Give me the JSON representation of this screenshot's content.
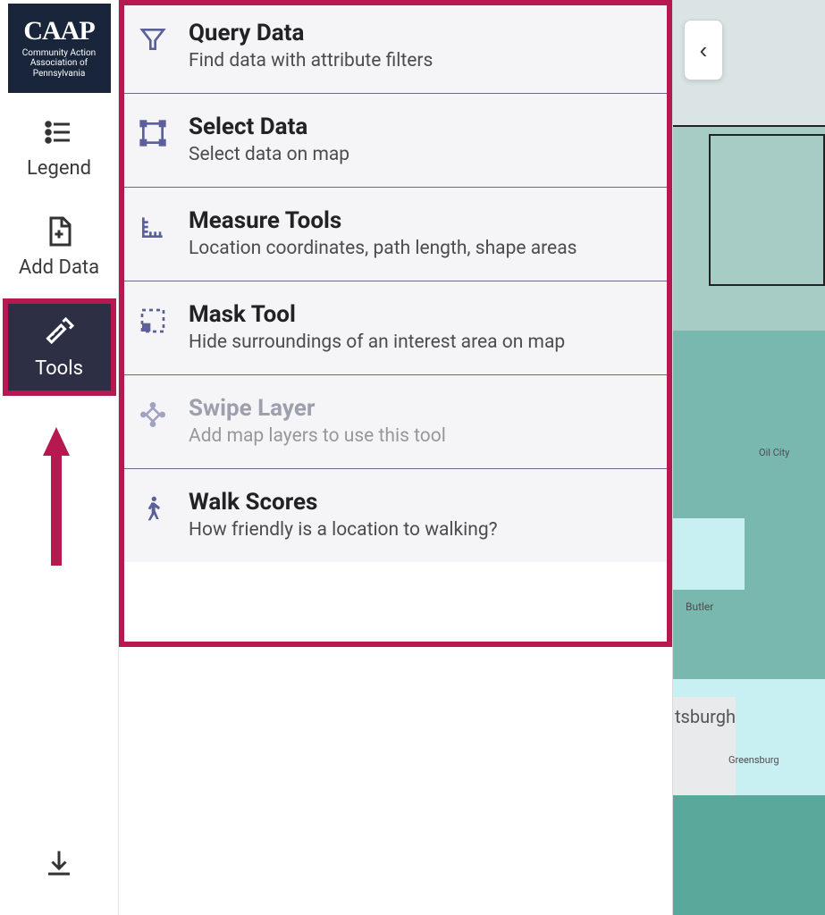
{
  "logo": {
    "main": "CAAP",
    "sub": "Community Action Association of Pennsylvania"
  },
  "rail": {
    "legend": "Legend",
    "add_data": "Add Data",
    "tools": "Tools"
  },
  "collapse_glyph": "‹",
  "tools_panel": {
    "items": [
      {
        "icon": "filter",
        "title": "Query Data",
        "desc": "Find data with attribute filters",
        "disabled": false
      },
      {
        "icon": "select",
        "title": "Select Data",
        "desc": "Select data on map",
        "disabled": false
      },
      {
        "icon": "measure",
        "title": "Measure Tools",
        "desc": "Location coordinates, path length, shape areas",
        "disabled": false
      },
      {
        "icon": "mask",
        "title": "Mask Tool",
        "desc": "Hide surroundings of an interest area on map",
        "disabled": false
      },
      {
        "icon": "swipe",
        "title": "Swipe Layer",
        "desc": "Add map layers to use this tool",
        "disabled": true
      },
      {
        "icon": "walk",
        "title": "Walk Scores",
        "desc": "How friendly is a location to walking?",
        "disabled": false
      }
    ]
  },
  "map": {
    "labels": {
      "oil_city": "Oil City",
      "butler": "Butler",
      "pittsburgh": "tsburgh",
      "greensburg": "Greensburg"
    },
    "colors": {
      "light": "#d6e4e3",
      "mid": "#a5cfc9",
      "teal": "#75b7ad",
      "pale_cyan": "#c4edef"
    }
  }
}
